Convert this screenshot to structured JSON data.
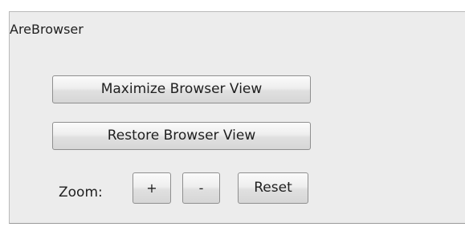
{
  "panel": {
    "title": "AreBrowser"
  },
  "buttons": {
    "maximize_label": "Maximize Browser View",
    "restore_label": "Restore Browser View"
  },
  "zoom": {
    "label": "Zoom:",
    "zoom_in_label": "+",
    "zoom_out_label": "-",
    "reset_label": "Reset"
  }
}
